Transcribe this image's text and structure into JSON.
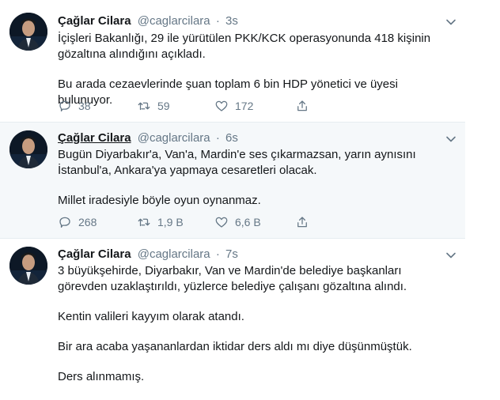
{
  "tweets": [
    {
      "name": "Çağlar Cilara",
      "handle": "@caglarcilara",
      "separator": "·",
      "time": "3s",
      "paragraphs": [
        "İçişleri Bakanlığı, 29 ile yürütülen PKK/KCK operasyonunda 418 kişinin gözaltına alındığını açıkladı.",
        "Bu arada cezaevlerinde şuan toplam 6 bin HDP yönetici ve üyesi bulunuyor."
      ],
      "replies": "38",
      "retweets": "59",
      "likes": "172"
    },
    {
      "name": "Çağlar Cilara",
      "handle": "@caglarcilara",
      "separator": "·",
      "time": "6s",
      "paragraphs": [
        "Bugün Diyarbakır'a, Van'a, Mardin'e ses çıkarmazsan, yarın aynısını İstanbul'a, Ankara'ya yapmaya cesaretleri olacak.",
        "Millet iradesiyle böyle oyun oynanmaz."
      ],
      "replies": "268",
      "retweets": "1,9 B",
      "likes": "6,6 B"
    },
    {
      "name": "Çağlar Cilara",
      "handle": "@caglarcilara",
      "separator": "·",
      "time": "7s",
      "paragraphs": [
        "3 büyükşehirde, Diyarbakır, Van ve Mardin'de belediye başkanları görevden uzaklaştırıldı, yüzlerce belediye çalışanı gözaltına alındı.",
        "Kentin valileri kayyım olarak atandı.",
        "Bir ara acaba yaşananlardan iktidar ders aldı mı diye düşünmüştük.",
        "Ders alınmamış."
      ]
    }
  ],
  "icons": {
    "reply": "reply-icon",
    "retweet": "retweet-icon",
    "like": "heart-icon",
    "share": "share-icon",
    "caret": "chevron-down-icon",
    "avatar": "avatar"
  },
  "colors": {
    "text": "#14171a",
    "secondary": "#657786",
    "border": "#e6ecf0",
    "hover_bg": "#f5f8fa"
  }
}
